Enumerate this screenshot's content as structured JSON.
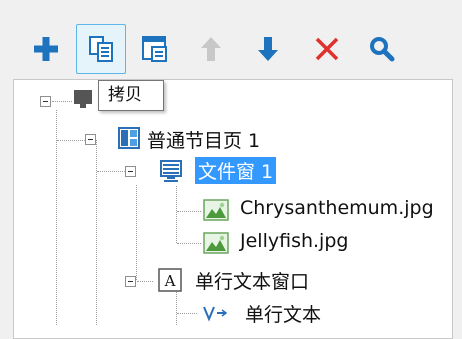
{
  "toolbar": {
    "buttons": [
      {
        "name": "add",
        "icon": "plus-icon"
      },
      {
        "name": "copy",
        "icon": "copy-page-icon",
        "active": true
      },
      {
        "name": "copy-window",
        "icon": "copy-window-icon"
      },
      {
        "name": "move-up",
        "icon": "arrow-up-icon",
        "disabled": true
      },
      {
        "name": "move-down",
        "icon": "arrow-down-icon"
      },
      {
        "name": "delete",
        "icon": "x-icon"
      },
      {
        "name": "search",
        "icon": "search-icon"
      }
    ],
    "colors": {
      "blue": "#1e73be",
      "red": "#e0312e",
      "disabled": "#c8c8c8"
    }
  },
  "tooltip": {
    "text": "拷贝"
  },
  "tree": {
    "nodes": [
      {
        "id": "root",
        "label": ""
      },
      {
        "id": "page",
        "label": "普通节目页 1"
      },
      {
        "id": "file-window",
        "label": "文件窗 1",
        "selected": true
      },
      {
        "id": "file-1",
        "label": "Chrysanthemum.jpg"
      },
      {
        "id": "file-2",
        "label": "Jellyfish.jpg"
      },
      {
        "id": "text-window",
        "label": "单行文本窗口"
      },
      {
        "id": "text-item",
        "label": "单行文本"
      }
    ],
    "selection_color": "#3399ff"
  }
}
